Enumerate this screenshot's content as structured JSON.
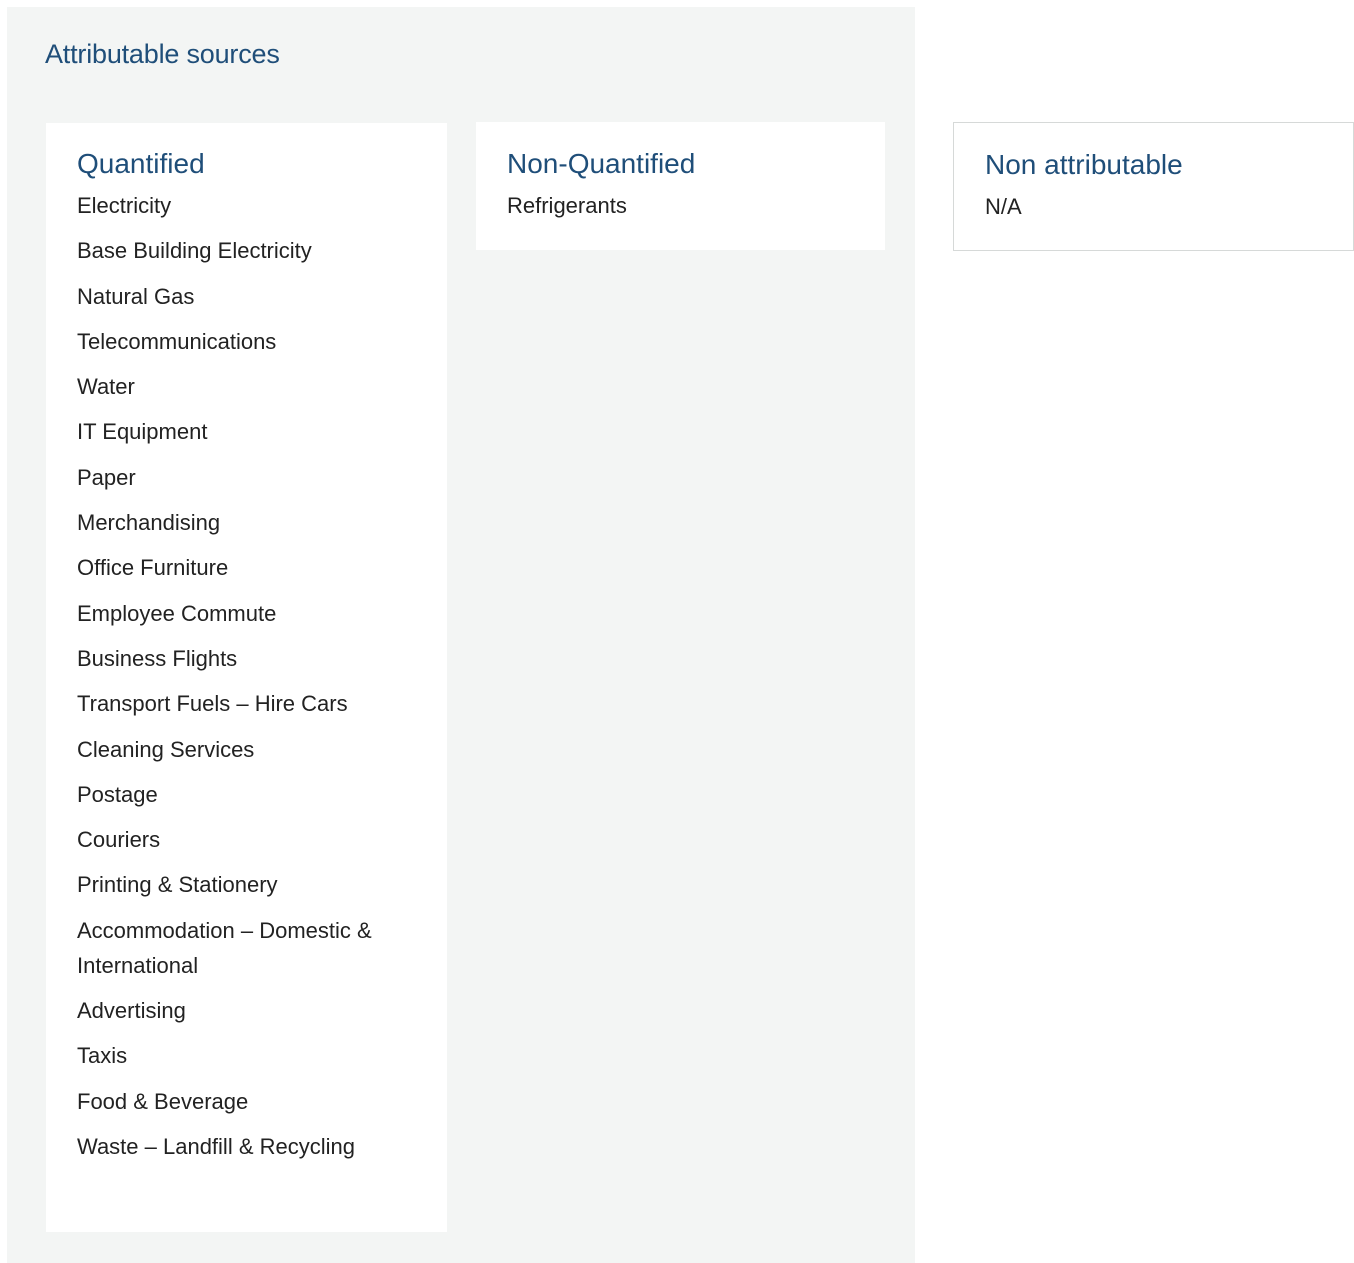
{
  "attributable": {
    "title": "Attributable sources",
    "quantified": {
      "title": "Quantified",
      "items": [
        "Electricity",
        "Base Building Electricity",
        "Natural Gas",
        "Telecommunications",
        "Water",
        "IT Equipment",
        "Paper",
        "Merchandising",
        "Office Furniture",
        "Employee Commute",
        "Business Flights",
        "Transport Fuels – Hire Cars",
        "Cleaning Services",
        "Postage",
        "Couriers",
        "Printing & Stationery",
        "Accommodation – Domestic & International",
        "Advertising",
        "Taxis",
        "Food & Beverage",
        "Waste – Landfill & Recycling"
      ]
    },
    "non_quantified": {
      "title": "Non-Quantified",
      "items": [
        "Refrigerants"
      ]
    }
  },
  "non_attributable": {
    "title": "Non attributable",
    "items": [
      "N/A"
    ]
  }
}
